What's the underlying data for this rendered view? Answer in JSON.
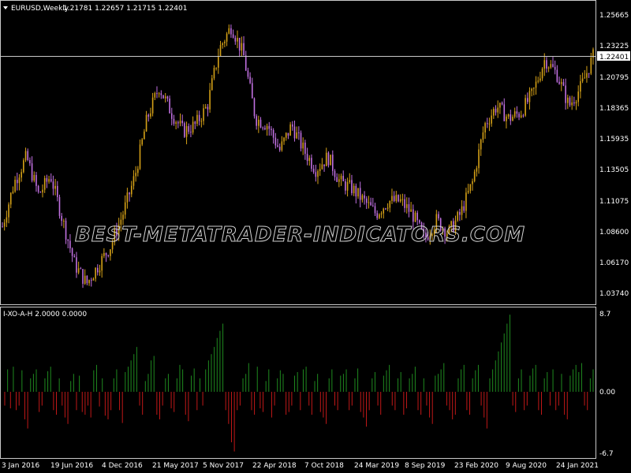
{
  "window": {
    "symbol_title": "EURUSD,Weekly",
    "ohlc": "1.21781 1.22657 1.21715 1.22401",
    "current_price_label": "1.22401"
  },
  "watermark": "BEST-METATRADER-INDICATORS.COM",
  "indicator": {
    "title": "I-XO-A-H 2.0000 0.0000",
    "scale_labels": [
      "8.7",
      "0.00",
      "-6.7"
    ]
  },
  "price_axis_labels": [
    "1.25665",
    "1.23225",
    "1.20795",
    "1.18365",
    "1.15935",
    "1.13505",
    "1.11075",
    "1.08600",
    "1.06170",
    "1.03740"
  ],
  "time_axis_labels": [
    "3 Jan 2016",
    "19 Jun 2016",
    "4 Dec 2016",
    "21 May 2017",
    "5 Nov 2017",
    "22 Apr 2018",
    "7 Oct 2018",
    "24 Mar 2019",
    "8 Sep 2019",
    "23 Feb 2020",
    "9 Aug 2020",
    "24 Jan 2021"
  ],
  "colors": {
    "background": "#000000",
    "bull_candle": "#d4a017",
    "bear_candle": "#c070e0",
    "hist_positive": "#1f8a1f",
    "hist_negative": "#c01818",
    "grid": "#c8c8c8"
  },
  "chart_data": [
    {
      "type": "candlestick",
      "symbol": "EURUSD",
      "timeframe": "Weekly",
      "ylim": [
        1.0374,
        1.2567
      ],
      "anchors": [
        {
          "x": "3 Jan 2016",
          "y": 1.09
        },
        {
          "x": "Feb 2016",
          "y": 1.125
        },
        {
          "x": "Apr 2016",
          "y": 1.145
        },
        {
          "x": "19 Jun 2016",
          "y": 1.115
        },
        {
          "x": "Aug 2016",
          "y": 1.13
        },
        {
          "x": "Oct 2016",
          "y": 1.095
        },
        {
          "x": "Nov 2016",
          "y": 1.06
        },
        {
          "x": "4 Dec 2016",
          "y": 1.045
        },
        {
          "x": "Jan 2017",
          "y": 1.06
        },
        {
          "x": "Mar 2017",
          "y": 1.075
        },
        {
          "x": "Apr 2017",
          "y": 1.1
        },
        {
          "x": "21 May 2017",
          "y": 1.13
        },
        {
          "x": "Jul 2017",
          "y": 1.175
        },
        {
          "x": "Aug 2017",
          "y": 1.2
        },
        {
          "x": "Sep 2017",
          "y": 1.18
        },
        {
          "x": "Oct 2017",
          "y": 1.165
        },
        {
          "x": "5 Nov 2017",
          "y": 1.17
        },
        {
          "x": "Dec 2017",
          "y": 1.185
        },
        {
          "x": "Jan 2018",
          "y": 1.23
        },
        {
          "x": "Feb 2018",
          "y": 1.248
        },
        {
          "x": "22 Apr 2018",
          "y": 1.225
        },
        {
          "x": "May 2018",
          "y": 1.175
        },
        {
          "x": "Jul 2018",
          "y": 1.17
        },
        {
          "x": "Aug 2018",
          "y": 1.15
        },
        {
          "x": "Sep 2018",
          "y": 1.17
        },
        {
          "x": "7 Oct 2018",
          "y": 1.15
        },
        {
          "x": "Nov 2018",
          "y": 1.135
        },
        {
          "x": "Jan 2019",
          "y": 1.145
        },
        {
          "x": "24 Mar 2019",
          "y": 1.125
        },
        {
          "x": "May 2019",
          "y": 1.12
        },
        {
          "x": "Jul 2019",
          "y": 1.11
        },
        {
          "x": "8 Sep 2019",
          "y": 1.1
        },
        {
          "x": "Oct 2019",
          "y": 1.11
        },
        {
          "x": "Dec 2019",
          "y": 1.11
        },
        {
          "x": "Jan 2020",
          "y": 1.1
        },
        {
          "x": "23 Feb 2020",
          "y": 1.08
        },
        {
          "x": "Mar 2020",
          "y": 1.095
        },
        {
          "x": "Apr 2020",
          "y": 1.085
        },
        {
          "x": "May 2020",
          "y": 1.1
        },
        {
          "x": "Jun 2020",
          "y": 1.125
        },
        {
          "x": "Jul 2020",
          "y": 1.17
        },
        {
          "x": "9 Aug 2020",
          "y": 1.185
        },
        {
          "x": "Sep 2020",
          "y": 1.175
        },
        {
          "x": "Oct 2020",
          "y": 1.18
        },
        {
          "x": "Nov 2020",
          "y": 1.195
        },
        {
          "x": "Dec 2020",
          "y": 1.222
        },
        {
          "x": "24 Jan 2021",
          "y": 1.21
        },
        {
          "x": "Mar 2021",
          "y": 1.185
        },
        {
          "x": "Apr 2021",
          "y": 1.2
        },
        {
          "x": "May 2021",
          "y": 1.224
        }
      ]
    },
    {
      "type": "bar",
      "title": "I-XO-A-H 2.0000 0.0000",
      "ylim": [
        -6.7,
        8.7
      ],
      "values": [
        -1.5,
        2.5,
        -1.8,
        2.8,
        -2,
        -1.5,
        2.4,
        -3,
        -4,
        1.5,
        2,
        2.5,
        -2.2,
        -1.5,
        1.5,
        2.3,
        2.8,
        -2,
        -2.5,
        1.5,
        -1.5,
        -2.8,
        -3.5,
        1.2,
        2,
        -2,
        1.8,
        -2.2,
        -2.5,
        -1.5,
        -2.8,
        2.4,
        3,
        -1.6,
        1.5,
        -2.6,
        -3,
        -2,
        1.5,
        2.5,
        -2,
        -3.4,
        2.2,
        2.8,
        3.5,
        4.2,
        5,
        -1.5,
        -2.5,
        1.2,
        2,
        3.5,
        4,
        -2.5,
        -3,
        -1.5,
        1.5,
        2,
        -1.8,
        -2.2,
        1.5,
        3,
        2.5,
        -2.5,
        -3.2,
        1.8,
        2.6,
        -2,
        1.5,
        -1.5,
        2.5,
        3.5,
        4.2,
        5,
        6,
        6.8,
        7.6,
        -2,
        -3.5,
        -5.5,
        -6.5,
        -2,
        -1.5,
        1.5,
        2,
        3.2,
        -2,
        -2.5,
        2.8,
        -1.8,
        -2.2,
        1.2,
        2.5,
        -2.8,
        -1.5,
        1.5,
        2.4,
        2,
        -2.5,
        -2.2,
        -1.5,
        1.8,
        2.2,
        -2,
        2.5,
        2.8,
        -1.5,
        -2.5,
        1.2,
        2,
        -2.2,
        -2.8,
        -3.5,
        1.5,
        2.5,
        -1.5,
        -2,
        1.8,
        2,
        2.5,
        -2,
        -1.5,
        1.5,
        2.6,
        -2.2,
        -2.8,
        -3.8,
        -2,
        1.5,
        2.2,
        -1.5,
        -2.5,
        1.8,
        2.4,
        3,
        -1.5,
        -2,
        1.5,
        2.2,
        -2.5,
        -1.8,
        1.5,
        2,
        2.8,
        -2,
        -2.5,
        1.5,
        -1.5,
        -2.8,
        -3.5,
        1.8,
        2,
        2.5,
        3.2,
        -1.5,
        -2,
        -3,
        -2.5,
        1.5,
        2.5,
        3,
        -2,
        -2.5,
        1.5,
        2.4,
        3,
        -1.5,
        -2.8,
        -4,
        1.5,
        2.5,
        3.5,
        4.5,
        5.5,
        6.5,
        7.6,
        8.6,
        -1.5,
        -2.2,
        1.5,
        2.5,
        -2,
        -1.5,
        1.8,
        2.6,
        3,
        -2,
        -2.5,
        1.5,
        2.2,
        -1.5,
        2.5,
        -2,
        -1.5,
        2,
        -2.5,
        -3,
        1.8,
        2.5,
        3,
        2.2,
        3.2,
        -1.5,
        -2,
        1.5,
        2.5
      ]
    }
  ]
}
